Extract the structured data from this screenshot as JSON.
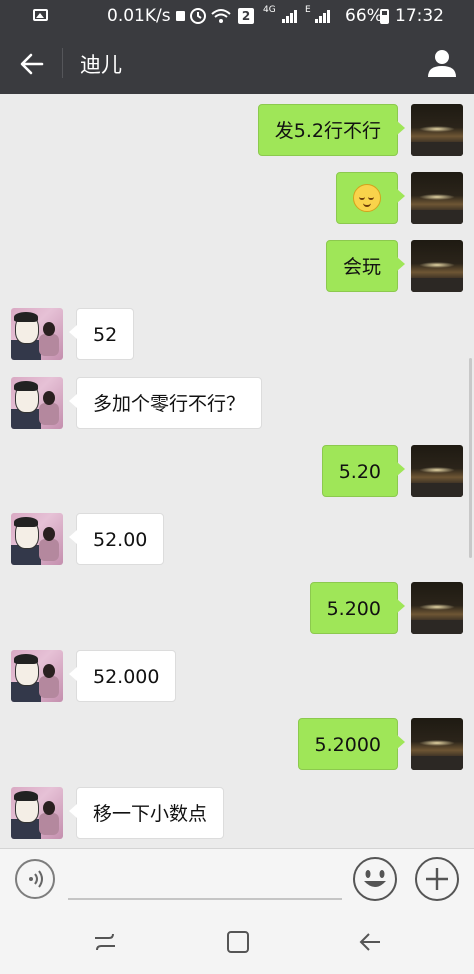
{
  "status_bar": {
    "net_speed": "0.01K/s",
    "sim_badge": "2",
    "network_4g": "4G",
    "network_e": "E",
    "battery": "66%",
    "time": "17:32",
    "icons": [
      "image-icon",
      "lock-icon",
      "alarm-icon",
      "wifi-icon",
      "signal-icon",
      "battery-icon"
    ]
  },
  "header": {
    "title": "迪儿",
    "back_icon": "back-arrow-icon",
    "profile_icon": "person-icon"
  },
  "messages": [
    {
      "side": "right",
      "text": "发5.2行不行"
    },
    {
      "side": "right",
      "text": "",
      "emoji": "smirk-emoji"
    },
    {
      "side": "right",
      "text": "会玩"
    },
    {
      "side": "left",
      "text": "52"
    },
    {
      "side": "left",
      "text": "多加个零行不行？"
    },
    {
      "side": "right",
      "text": "5.20"
    },
    {
      "side": "left",
      "text": "52.00"
    },
    {
      "side": "right",
      "text": "5.200"
    },
    {
      "side": "left",
      "text": "52.000"
    },
    {
      "side": "right",
      "text": "5.2000"
    },
    {
      "side": "left",
      "text": "移一下小数点"
    }
  ],
  "input_bar": {
    "voice_icon": "voice-icon",
    "emoji_icon": "emoji-icon",
    "plus_icon": "plus-icon"
  },
  "nav_bar": {
    "icons": [
      "recent-apps-icon",
      "home-icon",
      "back-icon"
    ]
  },
  "colors": {
    "header_bg": "#3a3b3f",
    "chat_bg": "#ebebeb",
    "outgoing_bubble": "#9fe658",
    "incoming_bubble": "#ffffff"
  }
}
